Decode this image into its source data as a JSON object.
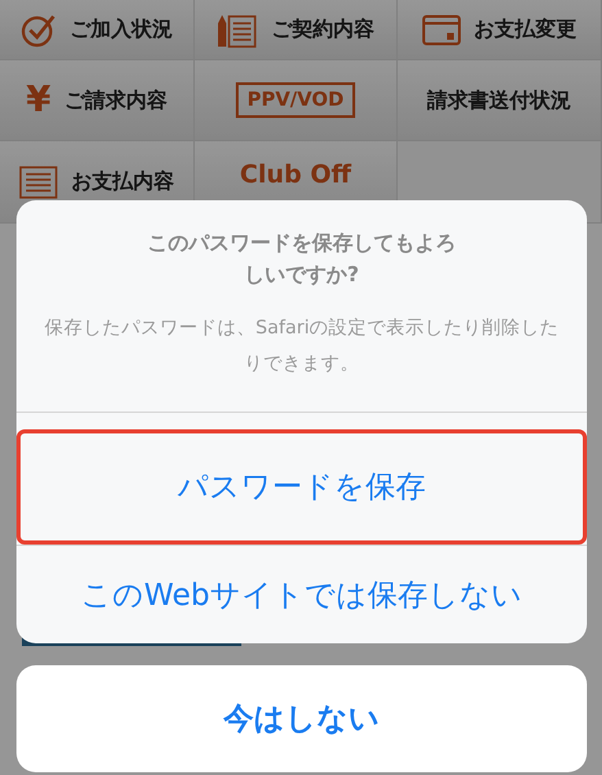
{
  "menu": [
    {
      "kind": "check",
      "label": "ご加入状況"
    },
    {
      "kind": "document",
      "label": "ご契約内容"
    },
    {
      "kind": "card",
      "label": "お支払変更"
    },
    {
      "kind": "yen",
      "icon_text": "¥",
      "label": "ご請求内容"
    },
    {
      "kind": "boxed",
      "label": "PPV/VOD"
    },
    {
      "kind": "plain",
      "label": "請求書送付状況"
    },
    {
      "kind": "list",
      "label": "お支払内容"
    },
    {
      "kind": "logo",
      "label": "Club Off"
    },
    {
      "kind": "empty"
    }
  ],
  "alert": {
    "title": "このパスワードを保存してもよろしいですか?",
    "message": "保存したパスワードは、Safariの設定で表示したり削除したりできます。",
    "actions": [
      {
        "label": "パスワードを保存",
        "highlighted": true
      },
      {
        "label": "このWebサイトでは保存しない",
        "highlighted": false
      }
    ]
  },
  "cancel": {
    "label": "今はしない"
  }
}
